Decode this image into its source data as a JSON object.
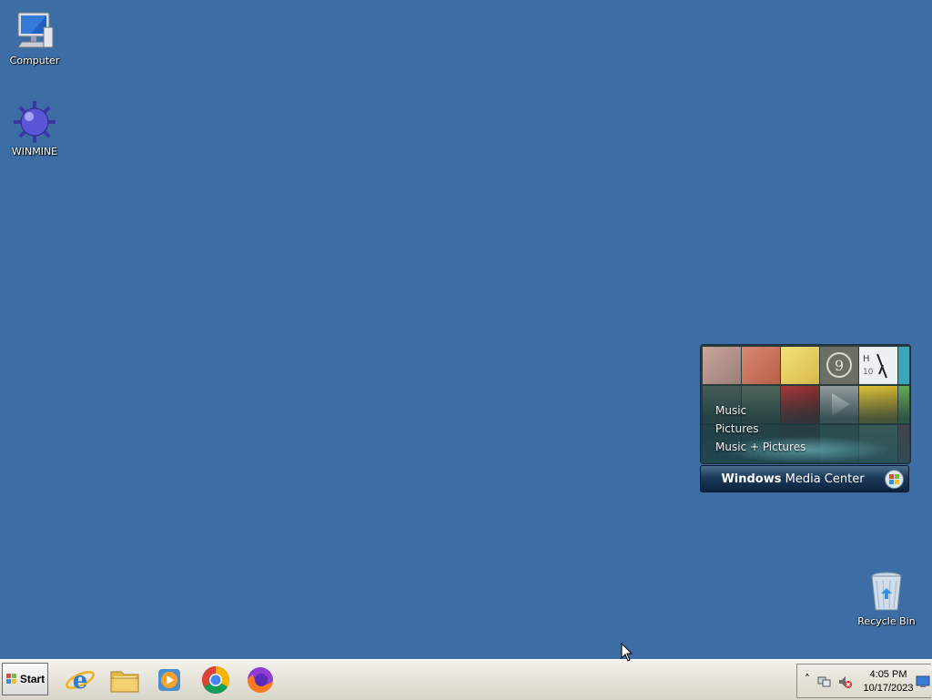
{
  "desktop": {
    "icons": [
      {
        "label": "Computer",
        "icon": "computer-icon"
      },
      {
        "label": "WINMINE",
        "icon": "minesweeper-mine-icon"
      },
      {
        "label": "Recycle Bin",
        "icon": "recycle-bin-icon"
      }
    ]
  },
  "media_center_gadget": {
    "menu": [
      "Music",
      "Pictures",
      "Music + Pictures"
    ],
    "title_bold": "Windows",
    "title_rest": " Media Center",
    "tile_texts": {
      "number": "9",
      "letter": "H",
      "digits": "10"
    }
  },
  "taskbar": {
    "start_label": "Start",
    "apps": [
      {
        "name": "Internet Explorer",
        "icon": "internet-explorer-icon"
      },
      {
        "name": "Windows Explorer",
        "icon": "folder-explorer-icon"
      },
      {
        "name": "Windows Media Player",
        "icon": "media-player-icon"
      },
      {
        "name": "Google Chrome",
        "icon": "chrome-icon"
      },
      {
        "name": "Firefox",
        "icon": "firefox-icon"
      }
    ],
    "tray": {
      "expand_glyph": "˄",
      "time": "4:05 PM",
      "date": "10/17/2023"
    }
  },
  "colors": {
    "desktop_background": "#3c6ea5",
    "taskbar": "#dcd8cc",
    "gadget_bar": "#1c3a5a"
  }
}
